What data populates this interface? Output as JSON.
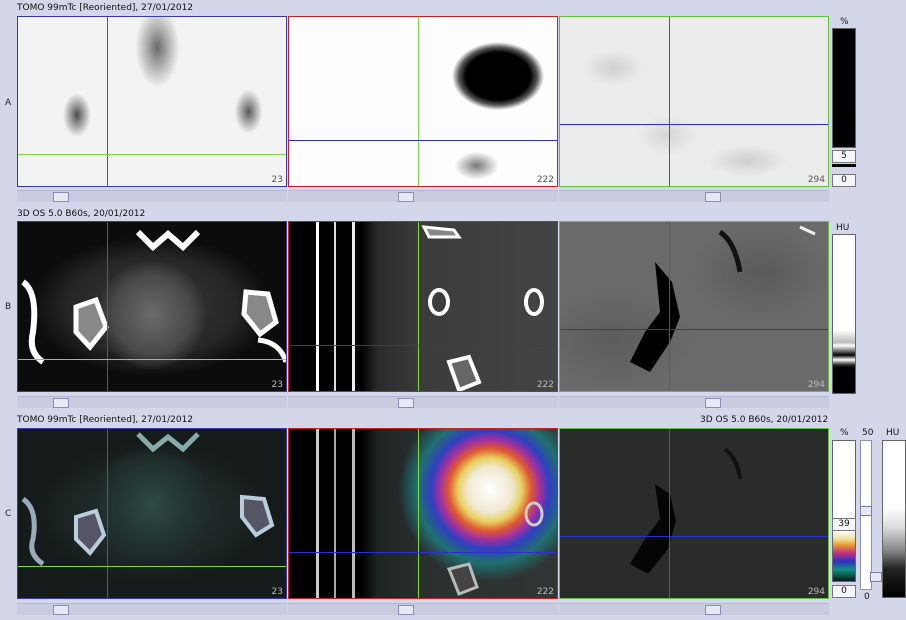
{
  "row_labels": [
    "A",
    "B",
    "C"
  ],
  "rows": {
    "a": {
      "title": "TOMO 99mTc [Reoriented], 27/01/2012",
      "slices": [
        "23",
        "222",
        "294"
      ]
    },
    "b": {
      "title": "3D  OS  5.0  B60s, 20/01/2012",
      "slices": [
        "23",
        "222",
        "294"
      ]
    },
    "c": {
      "title_left": "TOMO 99mTc [Reoriented], 27/01/2012",
      "title_right": "3D  OS  5.0  B60s, 20/01/2012",
      "slices": [
        "23",
        "222",
        "294"
      ]
    }
  },
  "scales": {
    "a": {
      "unit": "%",
      "upper_value": "5",
      "lower_value": "0"
    },
    "b": {
      "unit": "HU"
    },
    "c": {
      "unit_pct": "%",
      "unit_blend": "50",
      "unit_hu": "HU",
      "upper_value": "39",
      "lower_value": "0",
      "blend_lower": "0"
    }
  },
  "colors": {
    "background": "#d4d7ea",
    "crosshair_red": "#e0202a",
    "crosshair_green": "#7fd840",
    "crosshair_blue": "#2a30c8",
    "frame_blue": "#3a3aa8",
    "frame_red": "#c82020",
    "frame_green": "#60c040"
  }
}
